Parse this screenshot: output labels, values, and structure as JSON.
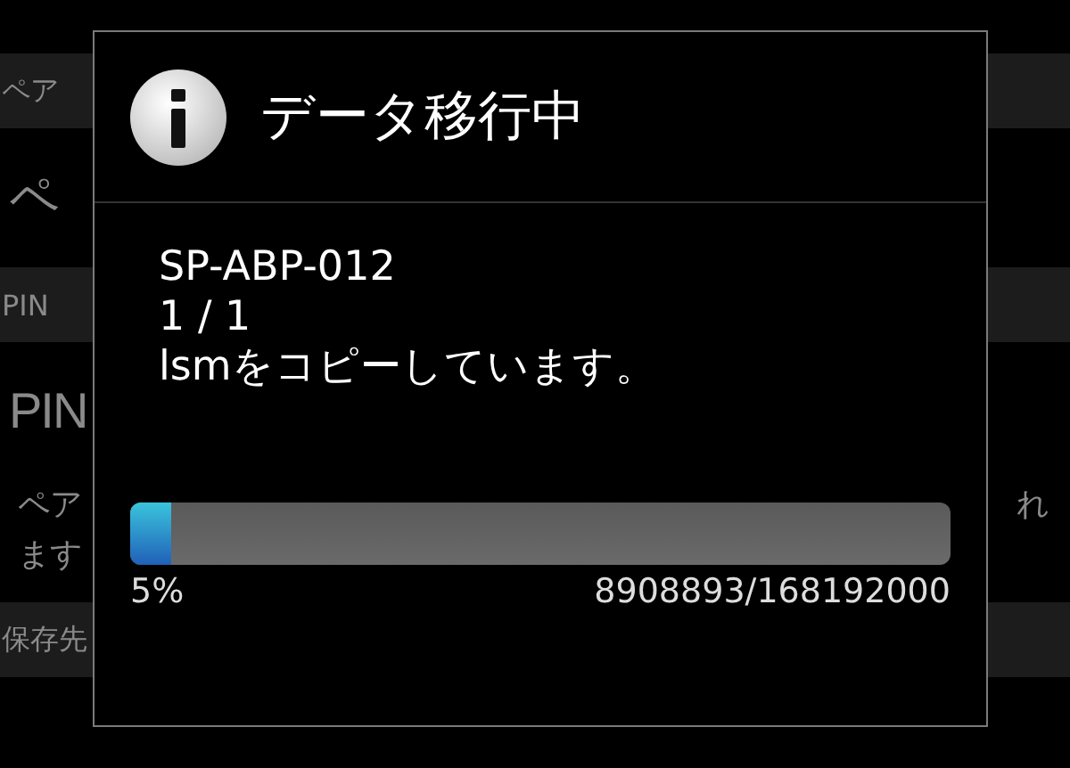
{
  "background": {
    "sections": [
      {
        "header": "ペア",
        "title": "ペ"
      },
      {
        "header": "PIN",
        "title": "PIN",
        "description_left": [
          "ペア",
          "ます"
        ],
        "description_right": "れ"
      },
      {
        "header": "保存先"
      }
    ]
  },
  "dialog": {
    "title": "データ移行中",
    "lines": [
      "SP-ABP-012",
      "1 / 1",
      "lsmをコピーしています。"
    ],
    "progress": {
      "level": 0.05,
      "percent": "5%",
      "count": "8908893/168192000"
    }
  }
}
